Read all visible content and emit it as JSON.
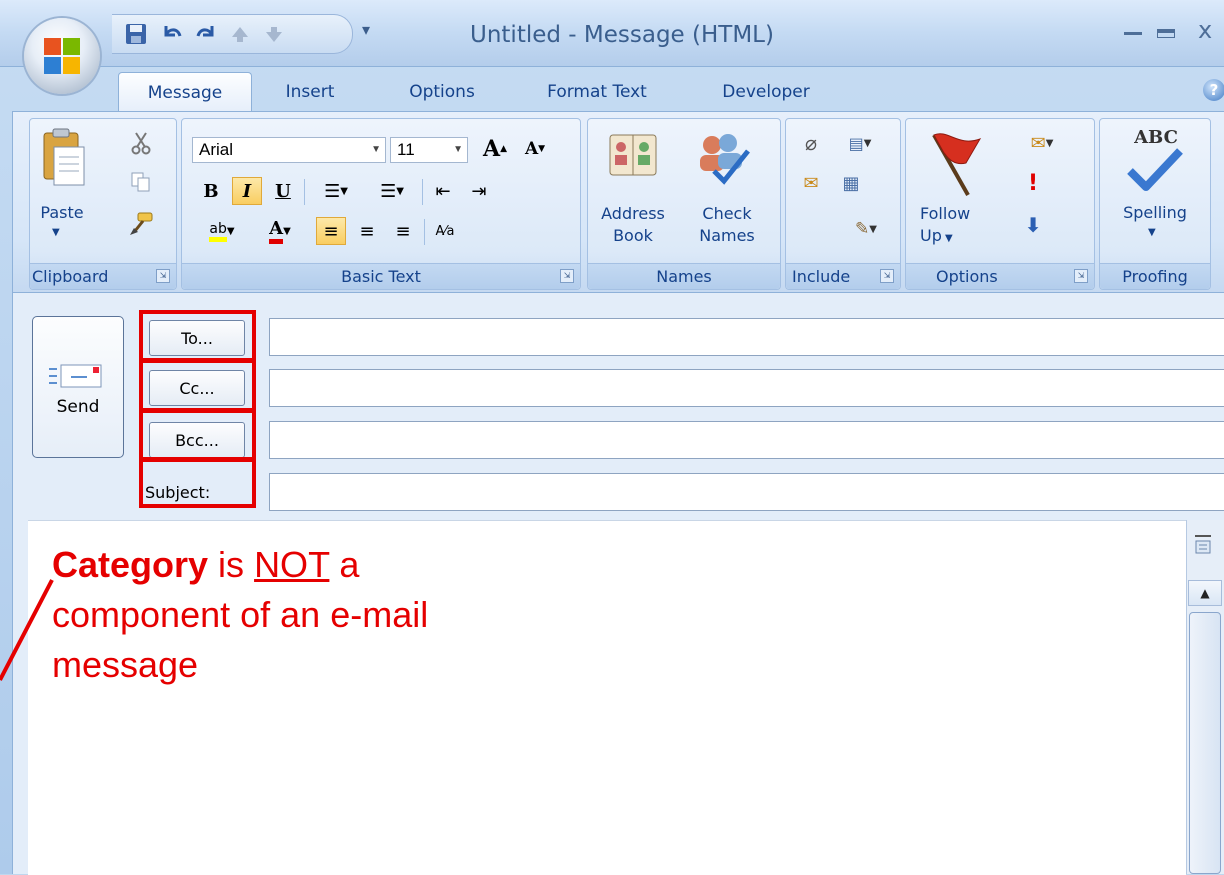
{
  "window": {
    "title": "Untitled - Message (HTML)",
    "controls": {
      "minimize": "–",
      "maximize": "□",
      "close": "x"
    }
  },
  "tabs": [
    "Message",
    "Insert",
    "Options",
    "Format Text",
    "Developer"
  ],
  "active_tab": "Message",
  "ribbon": {
    "clipboard": {
      "label": "Clipboard",
      "paste": "Paste"
    },
    "basic_text": {
      "label": "Basic Text",
      "font": "Arial",
      "size": "11"
    },
    "names": {
      "label": "Names",
      "address_book": [
        "Address",
        "Book"
      ],
      "check_names": [
        "Check",
        "Names"
      ]
    },
    "include": {
      "label": "Include"
    },
    "options": {
      "label": "Options",
      "follow_up": [
        "Follow",
        "Up"
      ]
    },
    "proofing": {
      "label": "Proofing",
      "spelling": "Spelling",
      "abc": "ABC"
    }
  },
  "compose": {
    "send": "Send",
    "to": "To...",
    "cc": "Cc...",
    "bcc": "Bcc...",
    "subject": "Subject:"
  },
  "annotation": {
    "bold": "Category",
    "mid": " is ",
    "underlined": "NOT",
    "rest1": " a",
    "line2": "component of an e-mail",
    "line3": "message",
    "color": "#e50000"
  }
}
